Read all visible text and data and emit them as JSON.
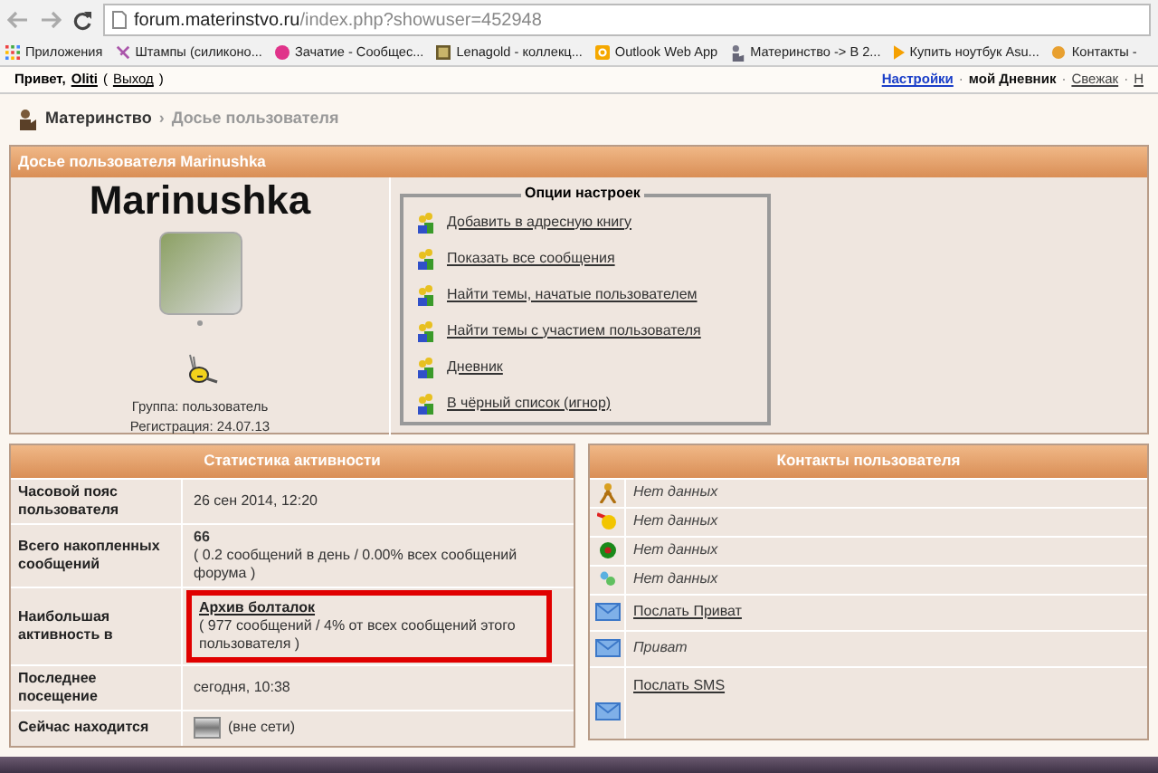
{
  "browser": {
    "url_host": "forum.materinstvo.ru",
    "url_path": "/index.php?showuser=452948",
    "bookmarks": [
      {
        "label": "Приложения",
        "kind": "apps"
      },
      {
        "label": "Штампы (силиконо...",
        "kind": "site"
      },
      {
        "label": "Зачатие - Сообщес...",
        "kind": "site"
      },
      {
        "label": "Lenagold - коллекц...",
        "kind": "site"
      },
      {
        "label": "Outlook Web App",
        "kind": "site"
      },
      {
        "label": "Материнство -> В 2...",
        "kind": "site"
      },
      {
        "label": "Купить ноутбук Asu...",
        "kind": "site"
      },
      {
        "label": "Контакты -",
        "kind": "site"
      }
    ]
  },
  "top_bar": {
    "greeting": "Привет,",
    "user": "Oliti",
    "logout_open": "(",
    "logout": "Выход",
    "logout_close": ")",
    "separator": "·",
    "links": [
      {
        "label": "Настройки",
        "kind": "primary"
      },
      {
        "label": "мой Дневник",
        "kind": "bold"
      },
      {
        "label": "Свежак",
        "kind": "plain"
      },
      {
        "label": "Н",
        "kind": "plain"
      }
    ]
  },
  "breadcrumb": {
    "items": [
      "Материнство",
      "Досье пользователя"
    ],
    "separator": "›"
  },
  "profile": {
    "title": "Досье пользователя Marinushka",
    "name": "Marinushka",
    "group": "Группа: пользователь",
    "registration": "Регистрация: 24.07.13",
    "options_title": "Опции настроек",
    "options": [
      "Добавить в адресную книгу",
      "Показать все сообщения",
      "Найти темы, начатые пользователем",
      "Найти темы с участием пользователя",
      "Дневник",
      "В чёрный список (игнор)"
    ]
  },
  "stats": {
    "title": "Статистика активности",
    "rows": [
      {
        "label": "Часовой пояс пользователя",
        "kind": "text",
        "main": "26 сен 2014, 12:20"
      },
      {
        "label": "Всего накопленных сообщений",
        "kind": "count",
        "main": "66",
        "note": "( 0.2 сообщений в день / 0.00% всех сообщений форума )"
      },
      {
        "label": "Наибольшая активность в",
        "kind": "forum",
        "main": "Архив болталок",
        "note": "( 977 сообщений / 4% от всех сообщений этого пользователя )"
      },
      {
        "label": "Последнее посещение",
        "kind": "text",
        "main": "сегодня, 10:38"
      },
      {
        "label": "Сейчас находится",
        "kind": "status",
        "main": "(вне сети)"
      }
    ]
  },
  "contacts": {
    "title": "Контакты пользователя",
    "rows": [
      {
        "kind": "info",
        "text": "Нет данных"
      },
      {
        "kind": "info",
        "text": "Нет данных"
      },
      {
        "kind": "info",
        "text": "Нет данных"
      },
      {
        "kind": "info",
        "text": "Нет данных"
      },
      {
        "kind": "link",
        "text": "Послать Приват"
      },
      {
        "kind": "info",
        "text": "Приват"
      },
      {
        "kind": "link",
        "text": "Послать SMS"
      }
    ]
  }
}
